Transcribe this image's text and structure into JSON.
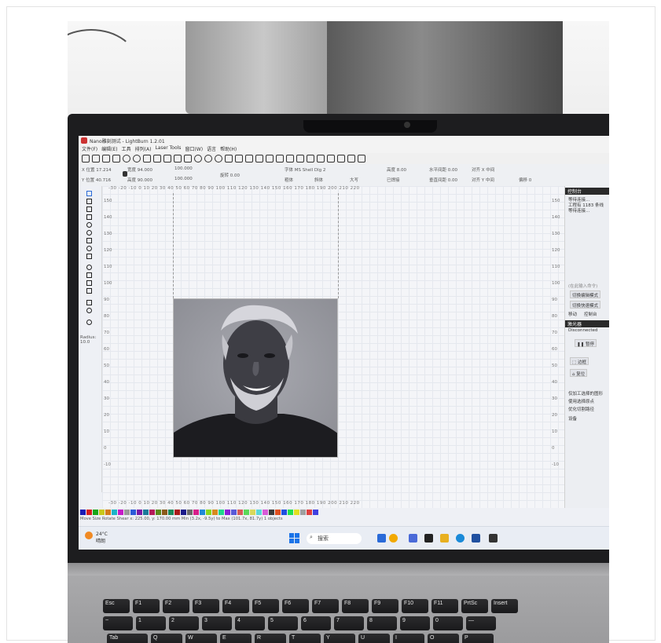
{
  "app": {
    "window_title": "Nano雕刻测试 - LightBurn 1.2.01",
    "menu": [
      "文件(F)",
      "编辑(E)",
      "工具",
      "排列(A)",
      "Laser Tools",
      "窗口(W)",
      "语言",
      "帮助(H)"
    ]
  },
  "numbar": {
    "x_pos": "X 位置 17.214",
    "y_pos": "Y 位置 40.716",
    "width": "宽度 94.000",
    "height": "高度 90.000",
    "pct1": "100.000",
    "pct2": "100.000",
    "rotate": "旋转 0.00",
    "font": "字体 MS Shell Dlg 2",
    "height_field": "高度 8.00",
    "hspace": "水平间距 0.00",
    "vspace": "垂直间距 0.00",
    "align_x": "对齐 X 中间",
    "align_y": "对齐 Y 中间",
    "bold": "粗体",
    "italic": "斜体",
    "upper": "大写",
    "welded": "已焊接",
    "offset": "偏移 0"
  },
  "canvas": {
    "ruler_top": "-30 -20 -10 0 10 20 30 40 50 60 70 80 90 100 110 120 130 140 150 160 170 180 190 200 210 220",
    "ruler_bottom": "-30 -20 -10 0 10 20 30 40 50 60 70 80 90 100 110 120 130 140 150 160 170 180 190 200 210 220",
    "y_labels": [
      "150",
      "140",
      "130",
      "120",
      "110",
      "100",
      "90",
      "80",
      "70",
      "60",
      "50",
      "40",
      "30",
      "20",
      "10",
      "0",
      "-10"
    ],
    "radius_label": "Radius:",
    "radius_value": "10.0"
  },
  "right_panel": {
    "console_title": "控制台",
    "console_lines": [
      "等待连接...",
      "工程有 1183 条线",
      "等待连接..."
    ],
    "cmd_placeholder": "(在此输入命令)",
    "btn_edit": "切换编辑模式",
    "btn_shortcut": "切换快速模式",
    "tab_move": "移动",
    "tab_console": "控制台",
    "laser_title": "激光器",
    "status": "Disconnected",
    "pause": "暂停",
    "frame": "边框",
    "home": "复位",
    "opt1": "仅加工选择的图形",
    "opt2": "使用选择原点",
    "opt3": "优化切割路径",
    "device": "设备"
  },
  "status_bar": {
    "text": "Move  Size  Rotate  Shear   x: 225.00, y: 170.00 mm   Min (3.2x, -9.5y) to Max (101.7x, 81.7y)  1 objects"
  },
  "taskbar": {
    "temp": "24°C",
    "weather": "晴朗",
    "search": "搜索"
  },
  "keyboard": {
    "row1": [
      "Esc",
      "F1",
      "F2",
      "F3",
      "F4",
      "F5",
      "F6",
      "F7",
      "F8",
      "F9",
      "F10",
      "F11",
      "PrtSc",
      "Insert"
    ],
    "row2": [
      "~",
      "1",
      "2",
      "3",
      "4",
      "5",
      "6",
      "7",
      "8",
      "9",
      "0",
      "—"
    ],
    "row3": [
      "Tab",
      "Q",
      "W",
      "E",
      "R",
      "T",
      "Y",
      "U",
      "I",
      "O",
      "P"
    ]
  },
  "colors": {
    "palette": [
      "#1b1bb5",
      "#d81e1e",
      "#19a619",
      "#c8c81a",
      "#d57a1a",
      "#1ab5c8",
      "#c61ac8",
      "#9a9a9a",
      "#2b5bd8",
      "#7a1aa6",
      "#1a7a9a",
      "#b51a5a",
      "#5a8a1a",
      "#8a5a1a",
      "#1a8a5a",
      "#aa1a1a",
      "#1a1a8a",
      "#6a6a6a",
      "#d81e8a",
      "#1e8ad8",
      "#8ad81e",
      "#d88a1e",
      "#1ed88a",
      "#8a1ed8",
      "#5a5ad8",
      "#d85a5a",
      "#5ad85a",
      "#d8d85a",
      "#5ad8d8",
      "#d85ad8",
      "#3a3a3a",
      "#e05020",
      "#2050e0",
      "#20e050",
      "#e0e020",
      "#a0a0a0",
      "#e04040",
      "#4040e0"
    ]
  }
}
